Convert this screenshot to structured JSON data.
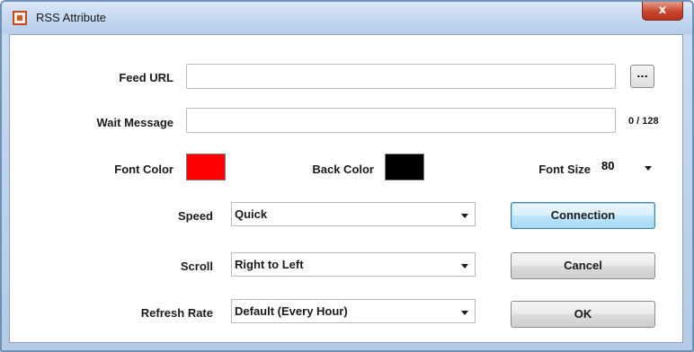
{
  "window": {
    "title": "RSS Attribute",
    "close_label": "x"
  },
  "icons": {
    "app": "rss-app-icon",
    "close": "close-icon",
    "dropdown": "chevron-down-icon"
  },
  "form": {
    "feed_url": {
      "label": "Feed URL",
      "value": "",
      "browse_label": "..."
    },
    "wait_message": {
      "label": "Wait Message",
      "value": "",
      "counter": "0 / 128"
    },
    "font_color": {
      "label": "Font Color",
      "color": "#ff0000"
    },
    "back_color": {
      "label": "Back Color",
      "color": "#000000"
    },
    "font_size": {
      "label": "Font Size",
      "value": "80"
    },
    "speed": {
      "label": "Speed",
      "value": "Quick"
    },
    "scroll": {
      "label": "Scroll",
      "value": "Right to Left"
    },
    "refresh_rate": {
      "label": "Refresh Rate",
      "value": "Default (Every Hour)"
    }
  },
  "buttons": {
    "connection": "Connection",
    "cancel": "Cancel",
    "ok": "OK"
  }
}
